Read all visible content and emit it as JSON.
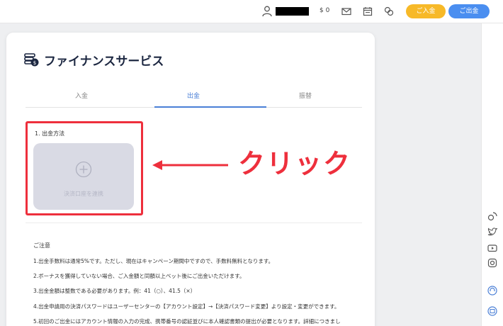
{
  "header": {
    "balance": "$ 0",
    "deposit_button": "ご入金",
    "withdraw_button": "ご出金"
  },
  "page": {
    "title": "ファイナンスサービス",
    "tabs": [
      {
        "label": "入金",
        "active": false
      },
      {
        "label": "出金",
        "active": true
      },
      {
        "label": "振替",
        "active": false
      }
    ]
  },
  "withdraw": {
    "section_label": "1. 出金方法",
    "link_account_label": "決済口座を連携"
  },
  "notes": {
    "title": "ご注意",
    "items": [
      "1.出金手数料は通常5%です。ただし、現在はキャンペーン期間中ですので、手数料無料となります。",
      "2.ボーナスを獲得していない場合、ご入金額と同額以上ベット後にご出金いただけます。",
      "3.出金金額は整数である必要があります。例：41（○）、41.5（×）",
      "4.出金申請用の決済パスワードはユーザーセンターの【アカウント設定】→【決済パスワード変更】より設定・変更ができます。",
      "5.初回のご出金にはアカウント情報の入力の完成、携帯番号の認証並びに本人確認書類の提出が必要となります。詳細につきまし"
    ]
  },
  "annotation": {
    "text": "クリック",
    "color": "#ee2f3c"
  },
  "colors": {
    "accent_blue": "#4a7fd6",
    "deposit_yellow": "#f7b928",
    "withdraw_blue": "#4a8ef0",
    "title_navy": "#1c2741"
  }
}
